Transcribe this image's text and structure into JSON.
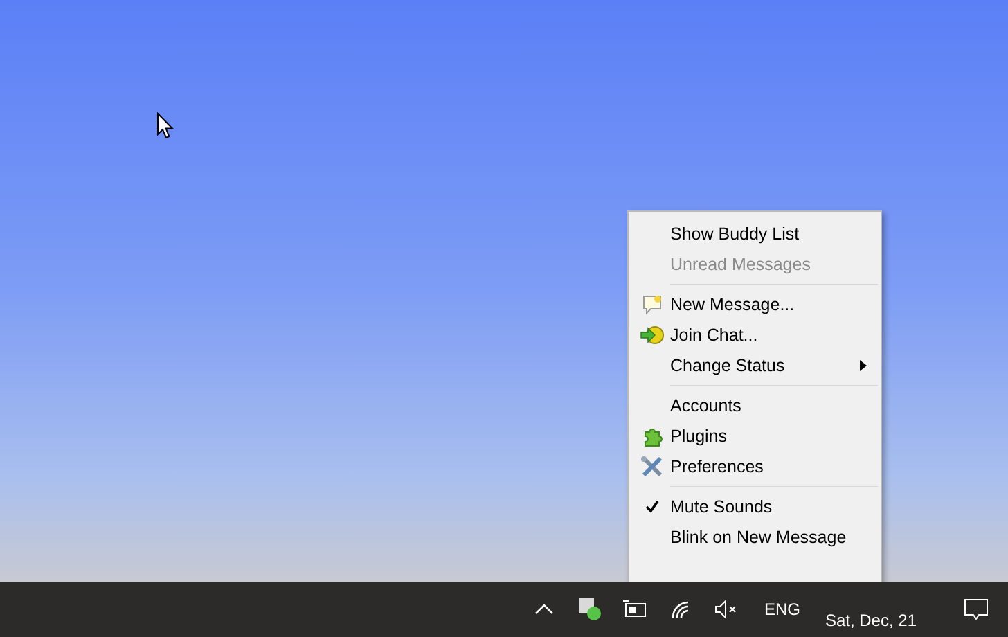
{
  "menu": {
    "items": [
      {
        "kind": "item",
        "label": "Show Buddy List",
        "disabled": false
      },
      {
        "kind": "item",
        "label": "Unread Messages",
        "disabled": true
      },
      {
        "kind": "separator"
      },
      {
        "kind": "item",
        "label": "New Message...",
        "disabled": false
      },
      {
        "kind": "item",
        "label": "Join Chat...",
        "disabled": false
      },
      {
        "kind": "item",
        "label": "Change Status",
        "disabled": false,
        "submenu": true
      },
      {
        "kind": "separator"
      },
      {
        "kind": "item",
        "label": "Accounts",
        "disabled": false
      },
      {
        "kind": "item",
        "label": "Plugins",
        "disabled": false
      },
      {
        "kind": "item",
        "label": "Preferences",
        "disabled": false
      },
      {
        "kind": "separator"
      },
      {
        "kind": "item",
        "label": "Mute Sounds",
        "disabled": false,
        "checked": true
      },
      {
        "kind": "item",
        "label": "Blink on New Message",
        "disabled": false,
        "checked": false
      }
    ]
  },
  "taskbar": {
    "language": "ENG",
    "date": "Sat, Dec, 21"
  }
}
